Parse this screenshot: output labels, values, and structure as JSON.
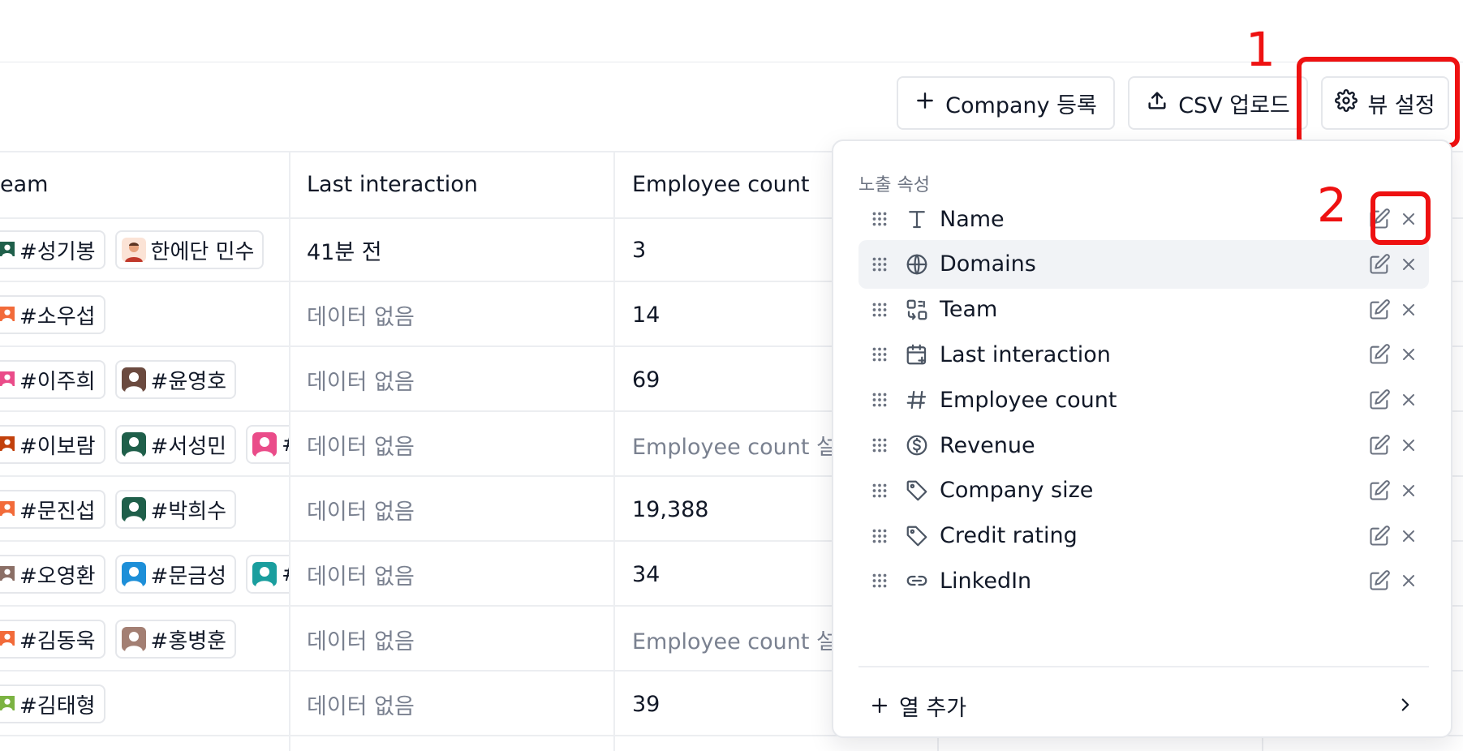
{
  "toolbar": {
    "add_company_label": "Company 등록",
    "csv_upload_label": "CSV 업로드",
    "view_settings_label": "뷰 설정"
  },
  "annotations": {
    "marker_1": "1",
    "marker_2": "2",
    "color": "#ee1111"
  },
  "table": {
    "columns": [
      "eam",
      "Last interaction",
      "Employee count"
    ],
    "rows": [
      {
        "team": [
          {
            "name": "#성기봉",
            "avatar": "#1f5f4a",
            "cut": true
          },
          {
            "name": "한에단 민수",
            "avatar": "photo",
            "cut": false
          }
        ],
        "last_interaction": "41분 전",
        "last_muted": false,
        "employee_count": "3",
        "emp_muted": false
      },
      {
        "team": [
          {
            "name": "#소우섭",
            "avatar": "#f26b3a",
            "cut": true
          }
        ],
        "last_interaction": "데이터 없음",
        "last_muted": true,
        "employee_count": "14",
        "emp_muted": false
      },
      {
        "team": [
          {
            "name": "#이주희",
            "avatar": "#ea4c89",
            "cut": true
          },
          {
            "name": "#윤영호",
            "avatar": "#6b4a3f",
            "cut": false
          }
        ],
        "last_interaction": "데이터 없음",
        "last_muted": true,
        "employee_count": "69",
        "emp_muted": false
      },
      {
        "team": [
          {
            "name": "#이보람",
            "avatar": "#c2410c",
            "cut": true
          },
          {
            "name": "#서성민",
            "avatar": "#1f5f4a",
            "cut": false
          },
          {
            "name": "#",
            "avatar": "#ea4c89",
            "cut": false
          }
        ],
        "last_interaction": "데이터 없음",
        "last_muted": true,
        "employee_count": "Employee count 설",
        "emp_muted": true
      },
      {
        "team": [
          {
            "name": "#문진섭",
            "avatar": "#f26b3a",
            "cut": true
          },
          {
            "name": "#박희수",
            "avatar": "#1f5f4a",
            "cut": false
          }
        ],
        "last_interaction": "데이터 없음",
        "last_muted": true,
        "employee_count": "19,388",
        "emp_muted": false
      },
      {
        "team": [
          {
            "name": "#오영환",
            "avatar": "#8b6f66",
            "cut": true
          },
          {
            "name": "#문금성",
            "avatar": "#1d8fd8",
            "cut": false
          },
          {
            "name": "#",
            "avatar": "#1a9e9e",
            "cut": false
          }
        ],
        "last_interaction": "데이터 없음",
        "last_muted": true,
        "employee_count": "34",
        "emp_muted": false
      },
      {
        "team": [
          {
            "name": "#김동욱",
            "avatar": "#f26b3a",
            "cut": true
          },
          {
            "name": "#홍병훈",
            "avatar": "#a37f73",
            "cut": false
          }
        ],
        "last_interaction": "데이터 없음",
        "last_muted": true,
        "employee_count": "Employee count 설",
        "emp_muted": true
      },
      {
        "team": [
          {
            "name": "#김태형",
            "avatar": "#7cb342",
            "cut": true
          }
        ],
        "last_interaction": "데이터 없음",
        "last_muted": true,
        "employee_count": "39",
        "emp_muted": false
      }
    ]
  },
  "view_settings": {
    "section_title": "노출 속성",
    "properties": [
      {
        "label": "Name",
        "icon": "text-type-icon",
        "highlighted": false
      },
      {
        "label": "Domains",
        "icon": "globe-icon",
        "highlighted": true
      },
      {
        "label": "Team",
        "icon": "team-relation-icon",
        "highlighted": false
      },
      {
        "label": "Last interaction",
        "icon": "calendar-plus-icon",
        "highlighted": false
      },
      {
        "label": "Employee count",
        "icon": "hash-icon",
        "highlighted": false
      },
      {
        "label": "Revenue",
        "icon": "dollar-circle-icon",
        "highlighted": false
      },
      {
        "label": "Company size",
        "icon": "tag-icon",
        "highlighted": false
      },
      {
        "label": "Credit rating",
        "icon": "tag-icon",
        "highlighted": false
      },
      {
        "label": "LinkedIn",
        "icon": "link-icon",
        "highlighted": false
      }
    ],
    "add_column_label": "열 추가"
  }
}
